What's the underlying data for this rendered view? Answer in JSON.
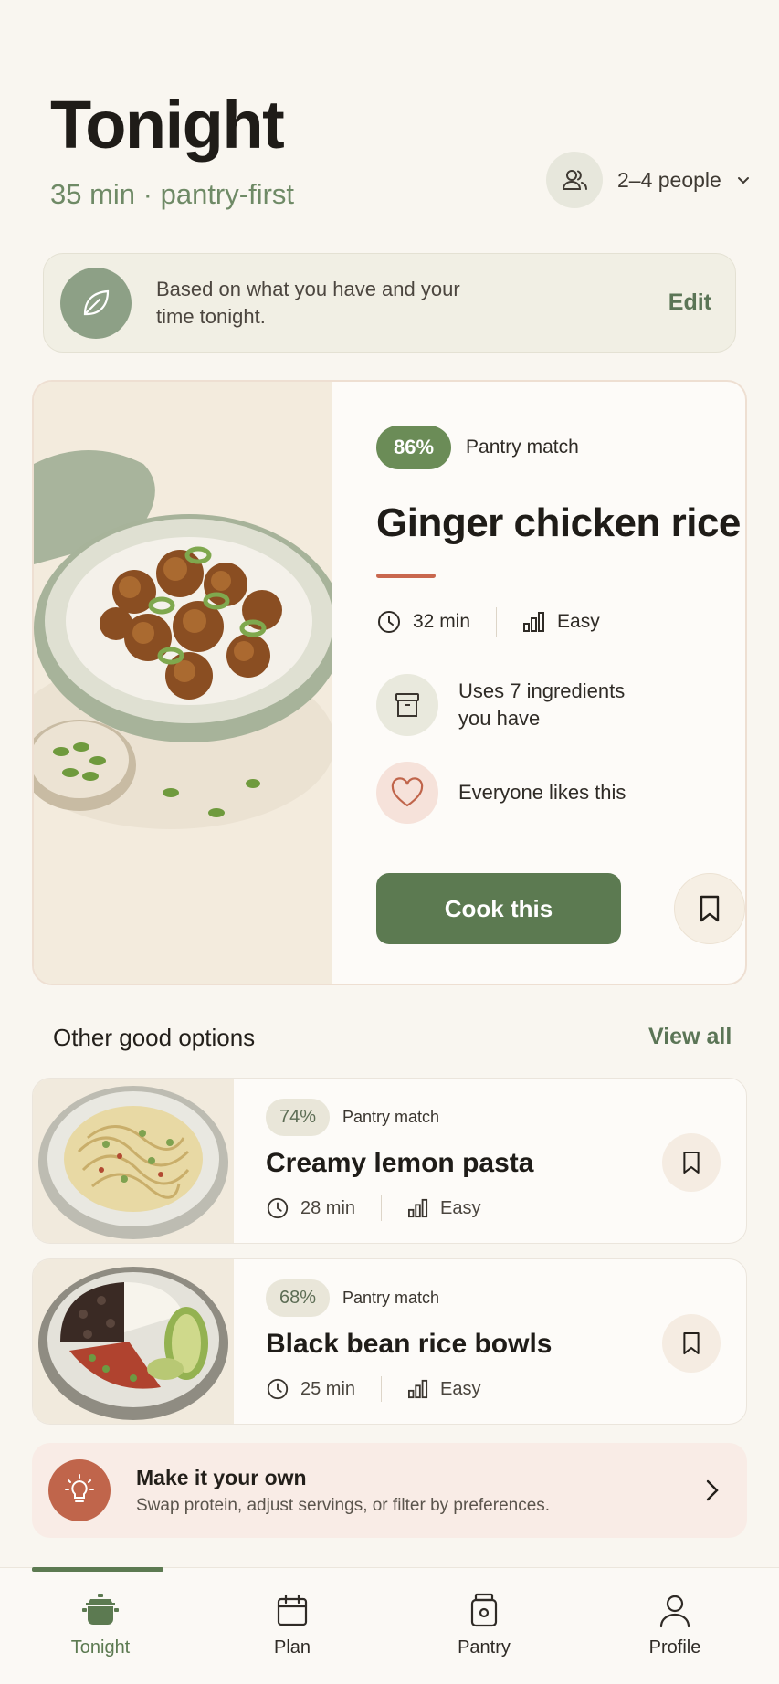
{
  "header": {
    "title": "Tonight",
    "subtitle": "35 min · pantry-first",
    "people_label": "2–4 people"
  },
  "banner": {
    "text": "Based on what you have and your time tonight.",
    "edit_label": "Edit"
  },
  "hero": {
    "match_percent": "86%",
    "match_label": "Pantry match",
    "title": "Ginger chicken rice",
    "time": "32 min",
    "difficulty": "Easy",
    "feature_ingredients": "Uses 7 ingredients you have",
    "feature_likes": "Everyone likes this",
    "cook_label": "Cook this"
  },
  "others": {
    "title": "Other good options",
    "view_all": "View all",
    "items": [
      {
        "match_percent": "74%",
        "match_label": "Pantry match",
        "name": "Creamy lemon pasta",
        "time": "28 min",
        "difficulty": "Easy"
      },
      {
        "match_percent": "68%",
        "match_label": "Pantry match",
        "name": "Black bean rice bowls",
        "time": "25 min",
        "difficulty": "Easy"
      }
    ]
  },
  "tip": {
    "title": "Make it your own",
    "text": "Swap protein, adjust servings, or filter by preferences."
  },
  "nav": {
    "tonight": "Tonight",
    "plan": "Plan",
    "pantry": "Pantry",
    "profile": "Profile"
  },
  "colors": {
    "accent_green": "#5c7a51",
    "match_green": "#6b8c57",
    "terracotta": "#c0654b",
    "background": "#f9f6f0"
  }
}
